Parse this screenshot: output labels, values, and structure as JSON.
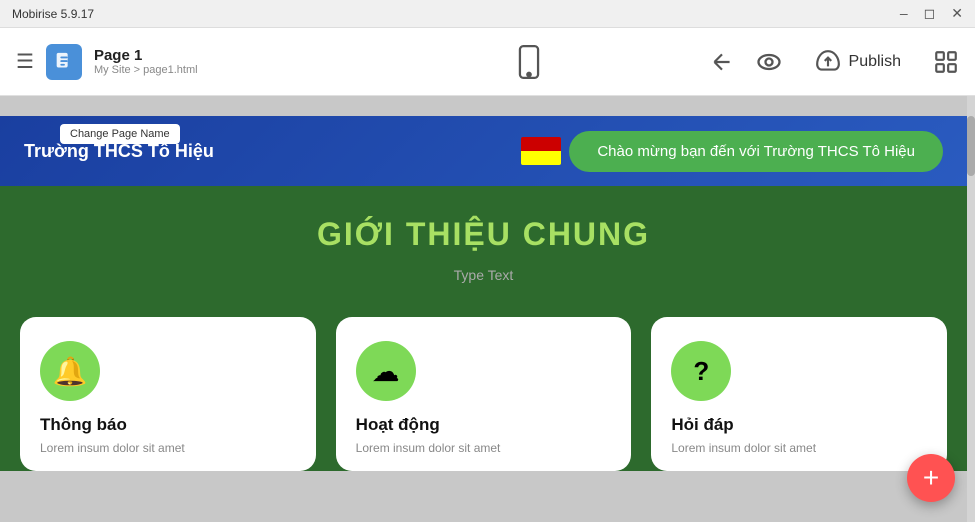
{
  "titlebar": {
    "title": "Mobirise 5.9.17",
    "controls": [
      "minimize",
      "maximize",
      "close"
    ]
  },
  "toolbar": {
    "hamburger": "☰",
    "page_icon_label": "P",
    "page_title": "Page 1",
    "page_breadcrumb": "My Site > page1.html",
    "phone_icon": "📱",
    "back_icon": "←",
    "preview_icon": "👁",
    "publish_icon": "☁",
    "publish_label": "Publish",
    "resize_icon": "⛶"
  },
  "header": {
    "change_page_name": "Change Page Name",
    "logo_text": "Trường THCS Tô Hiệu",
    "welcome_text": "Chào mừng bạn đến với Trường THCS Tô Hiệu"
  },
  "main_section": {
    "title": "GIỚI THIỆU CHUNG",
    "subtitle": "Type Text"
  },
  "cards": [
    {
      "icon": "🔔",
      "title": "Thông báo",
      "desc": "Lorem insum dolor sit amet"
    },
    {
      "icon": "☁",
      "title": "Hoạt động",
      "desc": "Lorem insum dolor sit amet"
    },
    {
      "icon": "?",
      "title": "Hỏi đáp",
      "desc": "Lorem insum dolor sit amet"
    }
  ],
  "fab": {
    "icon": "+"
  }
}
